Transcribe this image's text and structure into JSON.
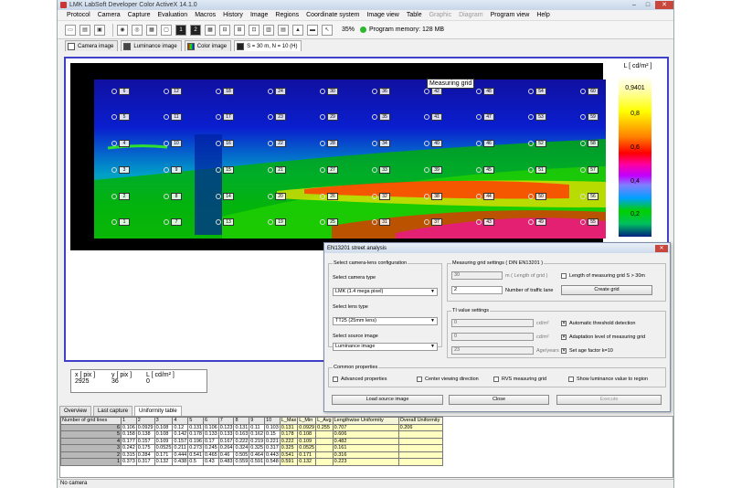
{
  "window": {
    "title": "LMK LabSoft Developer Color ActiveX  14.1.0"
  },
  "menu": [
    "Protocol",
    "Camera",
    "Capture",
    "Evaluation",
    "Macros",
    "History",
    "Image",
    "Regions",
    "Coordinate system",
    "Image view",
    "Table",
    "Graphic",
    "Diagram",
    "Program view",
    "Help"
  ],
  "menu_disabled": [
    "Graphic",
    "Diagram"
  ],
  "toolbar": {
    "zoom": "35%",
    "memory": "Program memory: 128 MB"
  },
  "image_tabs": [
    "Camera image",
    "Luminance image",
    "Color image",
    "S = 30 m, N = 10 (H)"
  ],
  "viewer": {
    "grid_label": "Measuring grid",
    "grid_rows": [
      [
        "6",
        "12",
        "18",
        "24",
        "30",
        "36",
        "42",
        "48",
        "54",
        "60"
      ],
      [
        "5",
        "11",
        "17",
        "23",
        "29",
        "35",
        "41",
        "47",
        "53",
        "59"
      ],
      [
        "4",
        "10",
        "16",
        "22",
        "28",
        "34",
        "40",
        "46",
        "52",
        "58"
      ],
      [
        "3",
        "9",
        "15",
        "21",
        "27",
        "33",
        "39",
        "45",
        "51",
        "57"
      ],
      [
        "2",
        "8",
        "14",
        "20",
        "26",
        "32",
        "38",
        "44",
        "50",
        "56"
      ],
      [
        "1",
        "7",
        "13",
        "19",
        "25",
        "31",
        "37",
        "43",
        "49",
        "55"
      ]
    ],
    "scale": {
      "unit": "L [ cd/m² ]",
      "ticks": [
        "0,9401",
        "0,8",
        "0,6",
        "0,4",
        "0,2"
      ]
    },
    "readout": {
      "h1": "x [ pix ]",
      "h2": "y [ pix ]",
      "h3": "L [ cd/m² ]",
      "v1": "2925",
      "v2": "36",
      "v3": "0"
    }
  },
  "bottom_tabs": [
    "Overview",
    "Last capture",
    "Uniformity table"
  ],
  "table": {
    "headers": [
      "Number of grid lines",
      "1",
      "2",
      "3",
      "4",
      "5",
      "6",
      "7",
      "8",
      "9",
      "10",
      "L_Max",
      "L_Min",
      "L_Avg",
      "Lengthwise Uniformity",
      "Overall Uniformity"
    ],
    "rows": [
      [
        "6",
        "0.106",
        "0.0929",
        "0.108",
        "0.12",
        "0.131",
        "0.106",
        "0.123",
        "0.131",
        "0.11",
        "0.103",
        "0.131",
        "0.0929",
        "0.255",
        "0.707",
        "0.206"
      ],
      [
        "5",
        "0.158",
        "0.138",
        "0.108",
        "0.142",
        "0.178",
        "0.133",
        "0.133",
        "0.163",
        "0.162",
        "0.15",
        "0.178",
        "0.108",
        "",
        "0.606",
        ""
      ],
      [
        "4",
        "0.177",
        "0.157",
        "0.109",
        "0.157",
        "0.196",
        "0.17",
        "0.167",
        "0.222",
        "0.219",
        "0.221",
        "0.222",
        "0.109",
        "",
        "0.482",
        ""
      ],
      [
        "3",
        "0.242",
        "0.175",
        "0.0525",
        "0.211",
        "0.273",
        "0.245",
        "0.264",
        "0.324",
        "0.325",
        "0.317",
        "0.325",
        "0.0525",
        "",
        "0.161",
        ""
      ],
      [
        "2",
        "0.315",
        "0.284",
        "0.171",
        "0.444",
        "0.541",
        "0.465",
        "0.46",
        "0.505",
        "0.464",
        "0.443",
        "0.541",
        "0.171",
        "",
        "0.316",
        ""
      ],
      [
        "1",
        "0.373",
        "0.317",
        "0.132",
        "0.438",
        "0.5",
        "0.43",
        "0.483",
        "0.559",
        "0.591",
        "0.548",
        "0.591",
        "0.132",
        "",
        "0.223",
        ""
      ]
    ]
  },
  "status": "No camera",
  "dialog": {
    "title": "EN13201 street analysis",
    "lens_group": "Select camera-lens configuration",
    "camera_type_label": "Select camera type",
    "camera_type": "LMK (1.4 mega pixel)",
    "lens_type_label": "Select lens type",
    "lens_type": "TT25 (25mm lens)",
    "source_label": "Select source image",
    "source": "Luminance image",
    "grid_group": "Measuring grid settings ( DIN EN13201 )",
    "grid_length": "30",
    "grid_length_unit": "m ( Length of grid )",
    "grid_length_cb": "Length of measuring grid S > 30m",
    "lanes": "2",
    "lanes_label": "Number of traffic lane",
    "create_grid": "Create grid",
    "ti_group": "TI value settings",
    "ti1": "0",
    "ti1_unit": "cd/m²",
    "ti1_cb": "Automatic threshold detection",
    "ti2": "0",
    "ti2_unit": "cd/m²",
    "ti2_cb": "Adaptation level of measuring grid",
    "ti3": "23",
    "ti3_unit": "Age/years",
    "ti3_cb": "Set age factor k=10",
    "common_group": "Common properties",
    "cb_adv": "Advanced properties",
    "cb_center": "Center viewing direction",
    "cb_rvs": "RVS measuring grid",
    "cb_show": "Show luminance value to region",
    "btn_load": "Load source image",
    "btn_close": "Close",
    "btn_exec": "Execute"
  }
}
